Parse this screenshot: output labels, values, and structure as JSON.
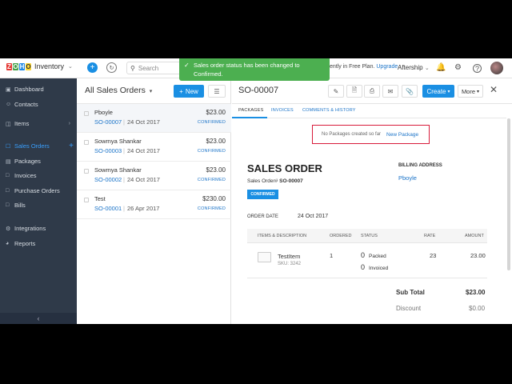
{
  "app": {
    "brand_name": "Inventory",
    "search_placeholder": "Search",
    "trial_text": "ently in Free Plan.",
    "upgrade_label": "Upgrade",
    "org_name": "Aftership",
    "toast": "Sales order status has been changed to Confirmed."
  },
  "sidebar": {
    "items": [
      {
        "label": "Dashboard",
        "icon": "dashboard-icon"
      },
      {
        "label": "Contacts",
        "icon": "contacts-icon"
      },
      {
        "label": "Items",
        "icon": "items-icon"
      },
      {
        "label": "Sales Orders",
        "icon": "sales-orders-icon"
      },
      {
        "label": "Packages",
        "icon": "packages-icon"
      },
      {
        "label": "Invoices",
        "icon": "invoices-icon"
      },
      {
        "label": "Purchase Orders",
        "icon": "purchase-orders-icon"
      },
      {
        "label": "Bills",
        "icon": "bills-icon"
      },
      {
        "label": "Integrations",
        "icon": "integrations-icon"
      },
      {
        "label": "Reports",
        "icon": "reports-icon"
      }
    ]
  },
  "list": {
    "title": "All Sales Orders",
    "new_label": "New",
    "orders": [
      {
        "customer": "Pboyle",
        "number": "SO-00007",
        "date": "24 Oct 2017",
        "amount": "$23.00",
        "status": "CONFIRMED"
      },
      {
        "customer": "Sowmya Shankar",
        "number": "SO-00003",
        "date": "24 Oct 2017",
        "amount": "$23.00",
        "status": "CONFIRMED"
      },
      {
        "customer": "Sowmya Shankar",
        "number": "SO-00002",
        "date": "24 Oct 2017",
        "amount": "$23.00",
        "status": "CONFIRMED"
      },
      {
        "customer": "Test",
        "number": "SO-00001",
        "date": "26 Apr 2017",
        "amount": "$230.00",
        "status": "CONFIRMED"
      }
    ]
  },
  "detail": {
    "so_number": "SO-00007",
    "create_label": "Create",
    "more_label": "More",
    "tabs": [
      "PACKAGES",
      "INVOICES",
      "COMMENTS & HISTORY"
    ],
    "no_packages_text": "No Packages created so far",
    "new_package_label": "New Package",
    "doc_title": "SALES ORDER",
    "order_number_label": "Sales Order#",
    "order_number": "SO-00007",
    "status_badge": "CONFIRMED",
    "billing_label": "BILLING ADDRESS",
    "billing_name": "Pboyle",
    "order_date_label": "ORDER DATE",
    "order_date": "24 Oct 2017",
    "columns": [
      "ITEMS & DESCRIPTION",
      "ORDERED",
      "STATUS",
      "RATE",
      "AMOUNT"
    ],
    "item": {
      "name": "TestItem",
      "sku": "SKU: 3242",
      "ordered": "1",
      "packed_qty": "0",
      "packed_label": "Packed",
      "invoiced_qty": "0",
      "invoiced_label": "Invoiced",
      "rate": "23",
      "amount": "23.00"
    },
    "subtotal_label": "Sub Total",
    "subtotal": "$23.00",
    "discount_label": "Discount",
    "discount": "$0.00"
  }
}
